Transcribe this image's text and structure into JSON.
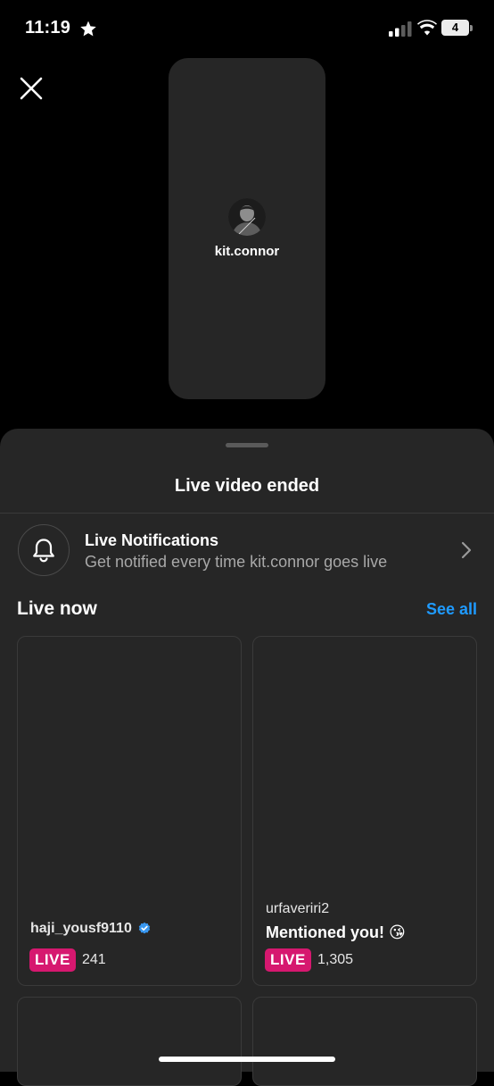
{
  "status_bar": {
    "time": "11:19",
    "battery_level": "4",
    "battery_color": "#e03a3a",
    "battery_fraction": 0.04,
    "icons": [
      "star-icon",
      "signal-icon",
      "wifi-icon",
      "battery-icon"
    ]
  },
  "preview": {
    "username": "kit.connor"
  },
  "sheet": {
    "title": "Live video ended",
    "notification": {
      "title": "Live Notifications",
      "subtitle": "Get notified every time kit.connor goes live"
    },
    "section_title": "Live now",
    "see_all": "See all",
    "cards": [
      {
        "username": "haji_yousf9110",
        "verified": true,
        "live_label": "LIVE",
        "viewers": "241"
      },
      {
        "username": "urfaveriri2",
        "message": "Mentioned you! 😘",
        "live_label": "LIVE",
        "viewers": "1,305"
      }
    ]
  },
  "colors": {
    "accent_link": "#1f9bff",
    "live_badge": "#d6186f",
    "sheet_bg": "#262626"
  }
}
